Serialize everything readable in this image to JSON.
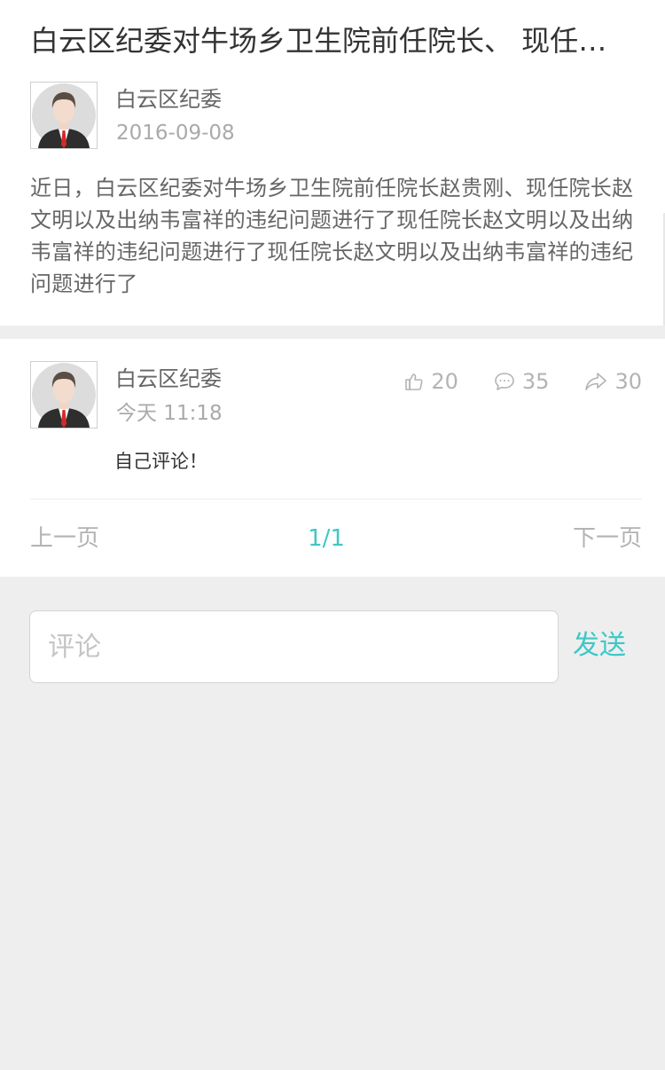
{
  "post": {
    "title": "白云区纪委对牛场乡卫生院前任院长、 现任院长赵贵刚以及出纳韦富祥的违纪问题进行了通报",
    "author": "白云区纪委",
    "date": "2016-09-08",
    "summary": "近日，白云区纪委对牛场乡卫生院前任院长赵贵刚、现任院长赵文明以及出纳韦富祥的违纪问题进行了现任院长赵文明以及出纳韦富祥的违纪问题进行了现任院长赵文明以及出纳韦富祥的违纪问题进行了",
    "avatar_icon": "person-avatar-icon"
  },
  "comments": [
    {
      "author": "白云区纪委",
      "time": "今天 11:18",
      "text": "自己评论！",
      "likes": "20",
      "replies": "35",
      "shares": "30"
    }
  ],
  "pager": {
    "prev_label": "上一页",
    "current": "1/1",
    "next_label": "下一页"
  },
  "comment_box": {
    "placeholder": "评论",
    "send_label": "发送"
  },
  "icons": {
    "like": "thumbs-up-icon",
    "reply": "chat-bubble-icon",
    "share": "share-arrow-icon"
  },
  "colors": {
    "accent": "#3fc7c7",
    "background": "#eeeeee",
    "muted": "#b3b3b3"
  }
}
